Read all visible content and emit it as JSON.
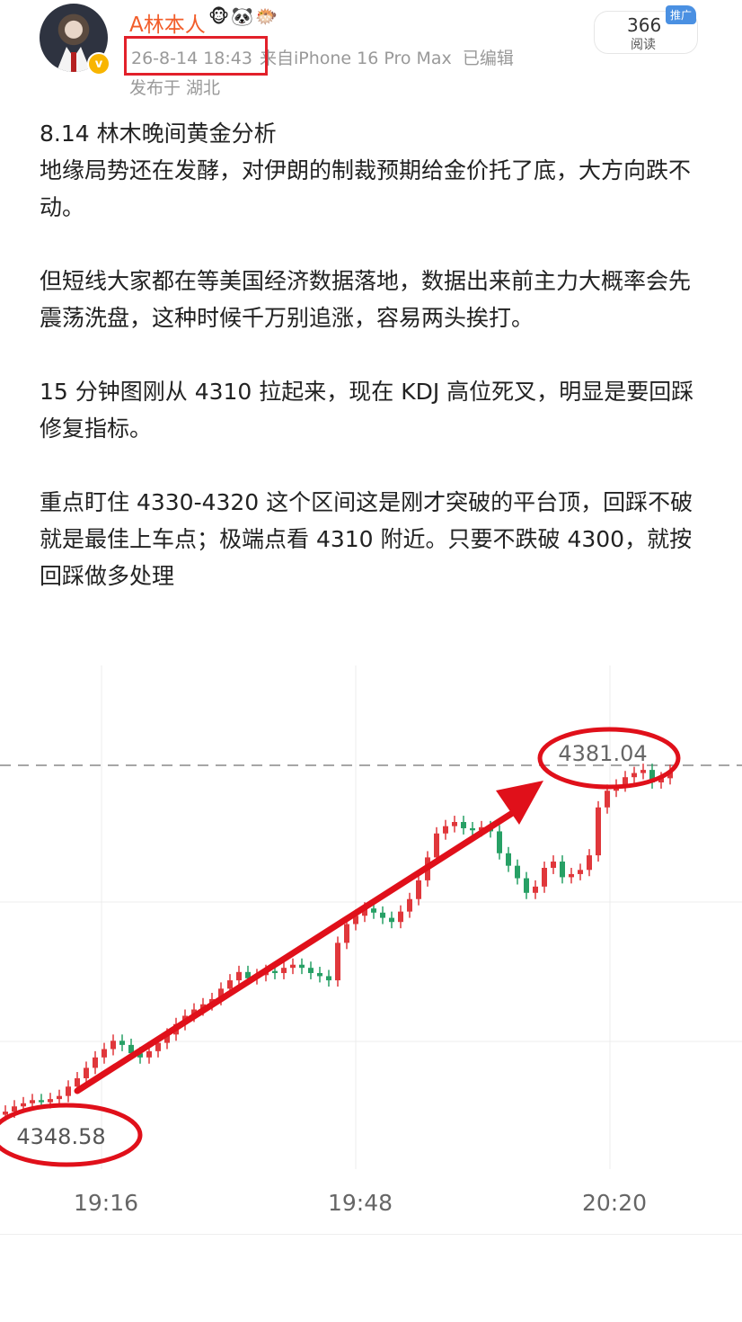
{
  "header": {
    "username": "A林本人",
    "emoji_badges": "🐵🐼🐡",
    "verified_icon": "v",
    "timestamp": "26-8-14 18:43",
    "device": "来自iPhone 16 Pro Max",
    "edited": "已编辑",
    "location": "发布于 湖北",
    "read_count": "366",
    "read_label": "阅读",
    "promo_tag": "推广"
  },
  "post": {
    "title": "8.14 林木晚间黄金分析",
    "paragraphs": [
      "地缘局势还在发酵，对伊朗的制裁预期给金价托了底，大方向跌不动。",
      "但短线大家都在等美国经济数据落地，数据出来前主力大概率会先震荡洗盘，这种时候千万别追涨，容易两头挨打。",
      "15 分钟图刚从 4310 拉起来，现在 KDJ 高位死叉，明显是要回踩修复指标。",
      "重点盯住 4330-4320 这个区间这是刚才突破的平台顶，回踩不破就是最佳上车点；极端点看 4310 附近。只要不跌破 4300，就按回踩做多处理"
    ]
  },
  "chart_data": {
    "type": "candlestick",
    "x_ticks": [
      "19:16",
      "19:48",
      "20:20"
    ],
    "annotations": [
      {
        "label": "4381.04"
      },
      {
        "label": "4348.58"
      }
    ],
    "high_value": 4381.04,
    "low_value": 4348.58,
    "dashed_line_value": 4381.04,
    "up_color": "#e0373b",
    "down_color": "#27a065"
  }
}
